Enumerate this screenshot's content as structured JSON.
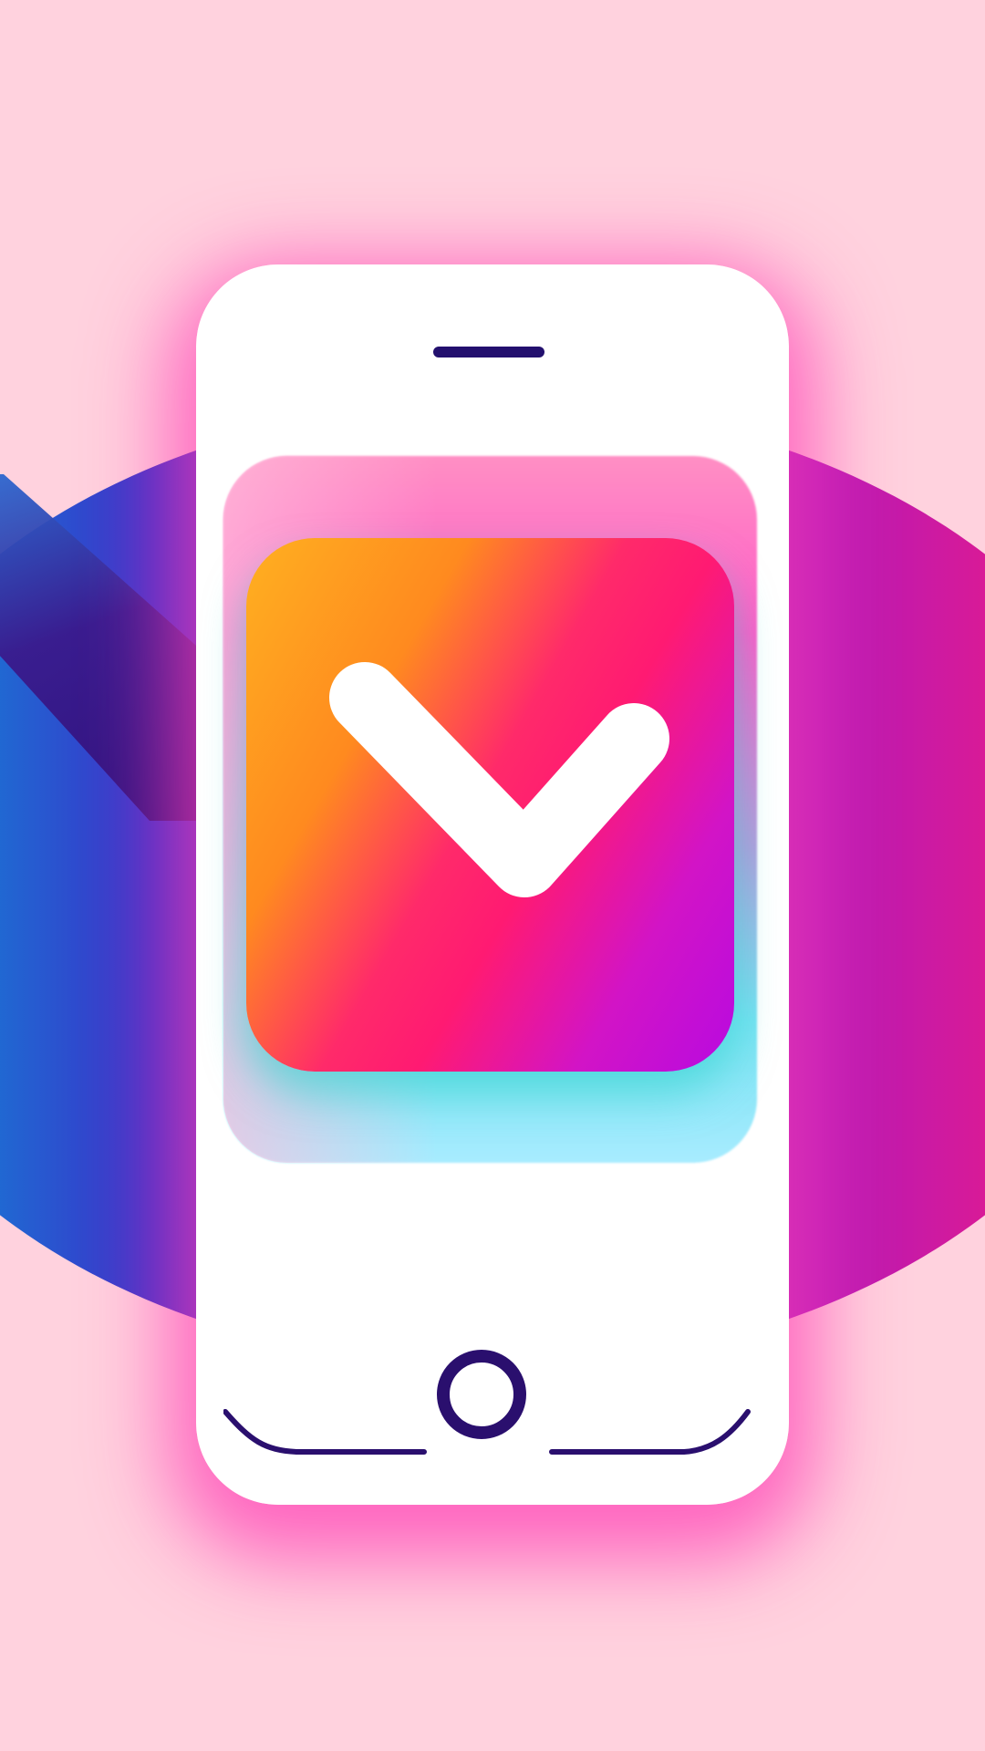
{
  "scene": {
    "type": "app-icon-illustration",
    "background_color": "#ffd2de",
    "disc_colors": [
      "#0fd2c0",
      "#3b2fc9",
      "#4a1fb5",
      "#b41ab8",
      "#ff1a74"
    ]
  },
  "phone": {
    "body_color": "#ffffff",
    "glow_color": "#ff3cb4",
    "speaker_color": "#23106e"
  },
  "app_tile": {
    "icon": "checkmark-icon",
    "front_gradient": [
      "#ffb020",
      "#ff2a6a",
      "#d214c6",
      "#b80ae0"
    ],
    "back_gradient": [
      "#ff8fc4",
      "#ff5cc8",
      "#76e2f2"
    ]
  },
  "home_button": {
    "icon": "home-button-icon",
    "color": "#2a0f6e"
  }
}
